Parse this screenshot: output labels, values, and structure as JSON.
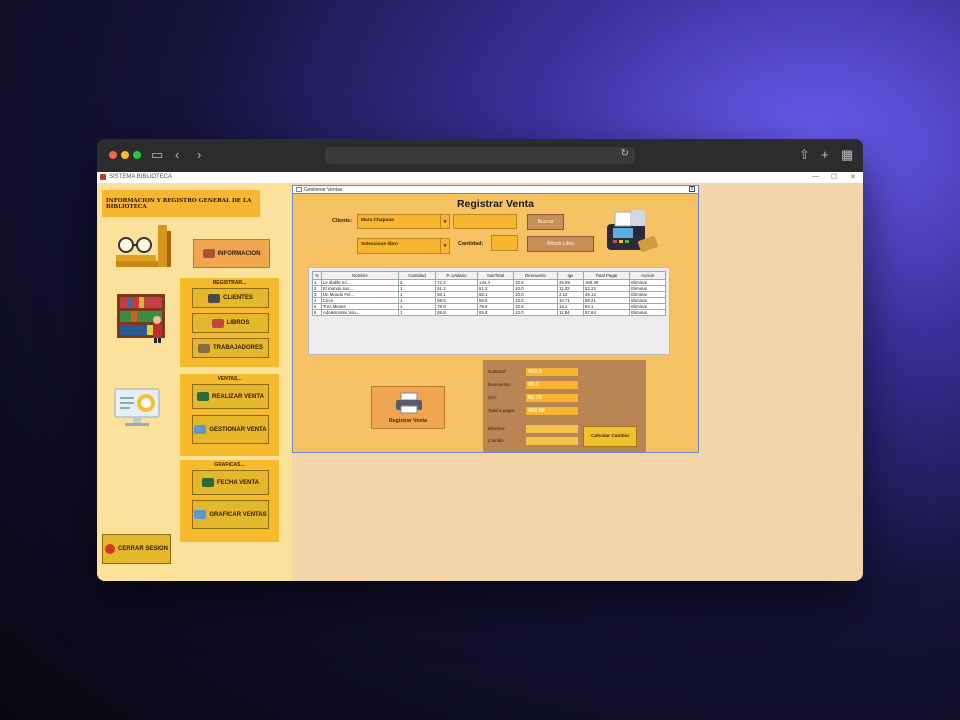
{
  "browser": {
    "url": ""
  },
  "app": {
    "window_title": "SISTEMA BIBLIOTECA",
    "header": "INFORMACION Y REGISTRO GENERAL DE LA BIBLIOTECA",
    "info_button": "INFORMACION",
    "registrar_panel": {
      "title": "REGISTRAR...",
      "buttons": [
        "CLIENTES",
        "LIBROS",
        "TRABAJADORES"
      ]
    },
    "ventas_panel": {
      "title": "VENTAS...",
      "buttons": [
        "REALIZAR VENTA",
        "GESTIONAR VENTA"
      ]
    },
    "graficas_panel": {
      "title": "GRAFICAS...",
      "buttons": [
        "FECHA VENTA",
        "GRAFICAR VENTAS"
      ]
    },
    "logout_button": "CERRAR SESION",
    "colors": {
      "sidebar": "#fce19a",
      "panel": "#f6bb2d",
      "content": "#f4d5aa",
      "dialog": "#f6c263"
    }
  },
  "dialog": {
    "window_title": "Gestionar Ventas",
    "title": "Registrar Venta",
    "cliente_label": "Cliente:",
    "cliente_value": "Mara Chapana",
    "buscar_button": "Buscar",
    "libro_value": "Seleccione libro",
    "cantidad_label": "Cantidad:",
    "anadir_button": "Añadir Libro",
    "table": {
      "headers": [
        "N",
        "Nombre",
        "Cantidad",
        "P. Unitario",
        "SubTotal",
        "Descuento",
        "Igv",
        "Total Pagar",
        "Accion"
      ],
      "rows": [
        [
          "1",
          "Le diable mi...",
          "2",
          "72.2",
          "144.4",
          "10.0",
          "25.99",
          "160.39",
          "Eliminar"
        ],
        [
          "2",
          "El mundo sus...",
          "1",
          "51.2",
          "51.2",
          "10.0",
          "11.02",
          "52.22",
          "Eliminar"
        ],
        [
          "3",
          "Un Mundo Fel...",
          "1",
          "58.1",
          "58.1",
          "10.0",
          "2.12",
          "49.12",
          "Eliminar"
        ],
        [
          "4",
          "Circe",
          "1",
          "59.5",
          "59.5",
          "10.0",
          "10.71",
          "59.21",
          "Eliminar"
        ],
        [
          "5",
          "Tres Meses",
          "1",
          "78.9",
          "78.9",
          "10.0",
          "14.2",
          "83.1",
          "Eliminar"
        ],
        [
          "6",
          "Adolescente Vou...",
          "1",
          "55.8",
          "55.8",
          "10.0",
          "11.84",
          "57.64",
          "Eliminar"
        ]
      ]
    },
    "registrar_button": "Registrar Venta",
    "totals": {
      "subtotal_label": "Subtotal:",
      "subtotal_value": "459.9",
      "descuento_label": "Descuento:",
      "descuento_value": "60.0",
      "igv_label": "IGV:",
      "igv_value": "82.78",
      "total_label": "Total a pagar:",
      "total_value": "482.68",
      "efectivo_label": "Efectivo:",
      "efectivo_value": "",
      "cambio_label": "Cambio:",
      "cambio_value": "",
      "calc_button": "Calcular Cambio"
    }
  }
}
